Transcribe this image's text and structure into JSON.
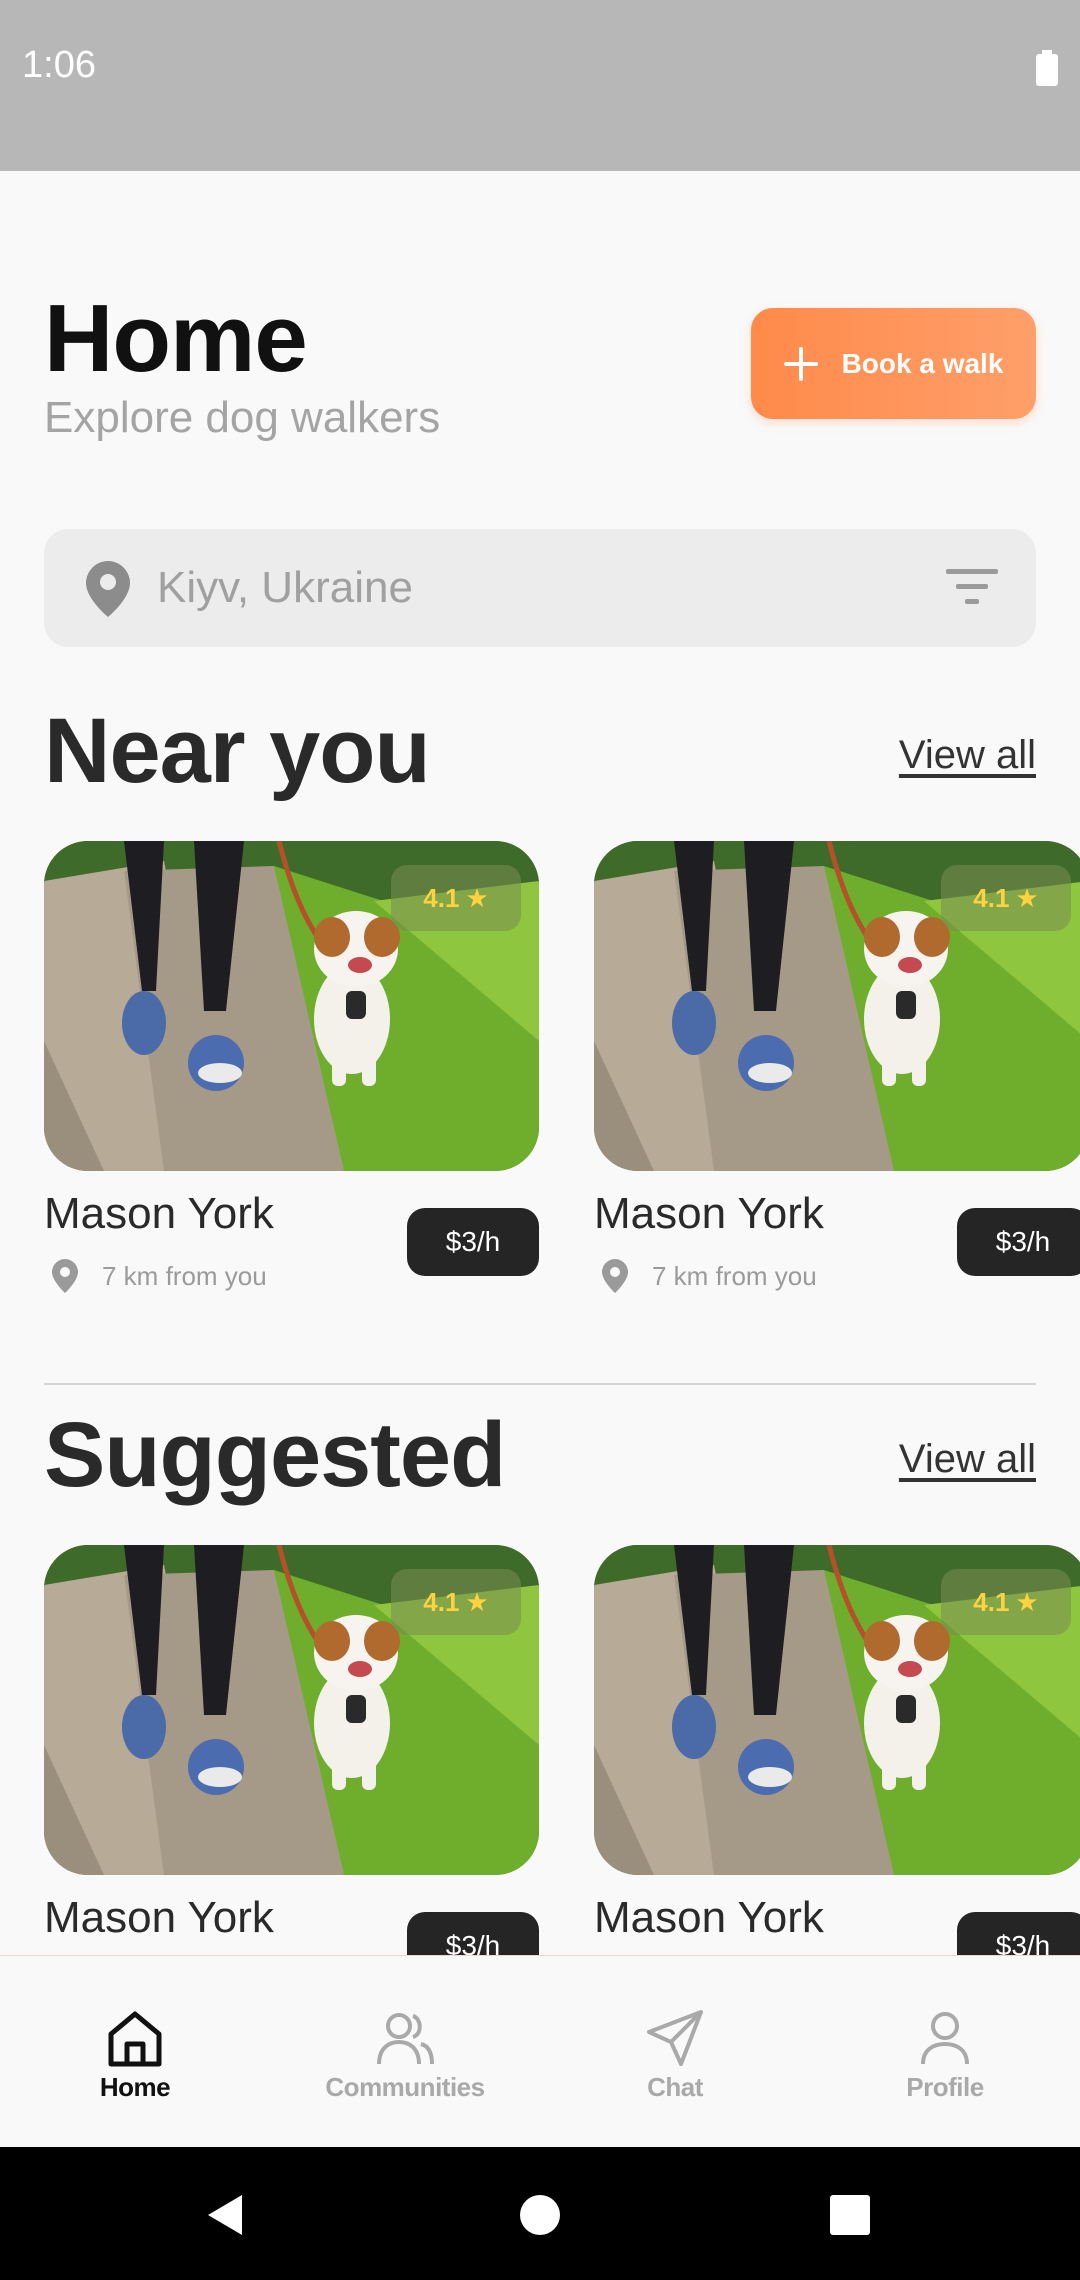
{
  "status_bar": {
    "time": "1:06"
  },
  "header": {
    "title": "Home",
    "subtitle": "Explore dog walkers",
    "book_button_label": "Book a walk",
    "accent_color": "#ff8a4a"
  },
  "search": {
    "placeholder": "Kiyv, Ukraine",
    "value": ""
  },
  "near_you": {
    "title": "Near you",
    "view_all": "View all",
    "cards": [
      {
        "name": "Mason York",
        "rating": "4.1",
        "price": "$3/h",
        "distance": "7 km from you"
      },
      {
        "name": "Mason York",
        "rating": "4.1",
        "price": "$3/h",
        "distance": "7 km from you"
      }
    ]
  },
  "suggested": {
    "title": "Suggested",
    "view_all": "View all",
    "cards": [
      {
        "name": "Mason York",
        "rating": "4.1",
        "price": "$3/h"
      },
      {
        "name": "Mason York",
        "rating": "4.1",
        "price": "$3/h"
      }
    ]
  },
  "tabbar": {
    "items": [
      {
        "label": "Home",
        "icon": "home-icon",
        "active": true
      },
      {
        "label": "Communities",
        "icon": "users-icon",
        "active": false
      },
      {
        "label": "Chat",
        "icon": "send-icon",
        "active": false
      },
      {
        "label": "Profile",
        "icon": "user-icon",
        "active": false
      }
    ]
  },
  "system_nav": {
    "icons": [
      "back-icon",
      "home-circle-icon",
      "recents-icon"
    ]
  }
}
